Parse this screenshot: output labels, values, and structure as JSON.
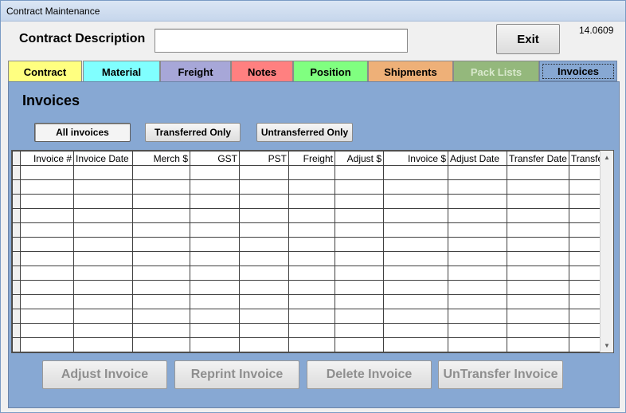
{
  "window": {
    "title": "Contract Maintenance"
  },
  "header": {
    "contract_description_label": "Contract Description",
    "contract_description_value": "",
    "exit_label": "Exit",
    "version": "14.0609"
  },
  "tabs": [
    {
      "label": "Contract",
      "color": "#ffff80"
    },
    {
      "label": "Material",
      "color": "#80ffff"
    },
    {
      "label": "Freight",
      "color": "#a7a7d8"
    },
    {
      "label": "Notes",
      "color": "#ff8080"
    },
    {
      "label": "Position",
      "color": "#80ff80"
    },
    {
      "label": "Shipments",
      "color": "#eeb078"
    },
    {
      "label": "Pack Lists",
      "color": "#94b87c"
    },
    {
      "label": "Invoices",
      "color": "#87a8d3"
    }
  ],
  "panel": {
    "title": "Invoices",
    "filters": {
      "all": "All invoices",
      "transferred": "Transferred Only",
      "untransferred": "Untransferred Only"
    }
  },
  "grid": {
    "columns": [
      "Invoice #",
      "Invoice Date",
      "Merch $",
      "GST",
      "PST",
      "Freight",
      "Adjust $",
      "Invoice $",
      "Adjust Date",
      "Transfer Date",
      "Transfe"
    ]
  },
  "actions": {
    "adjust": "Adjust Invoice",
    "reprint": "Reprint Invoice",
    "delete": "Delete Invoice",
    "untransfer": "UnTransfer Invoice"
  }
}
